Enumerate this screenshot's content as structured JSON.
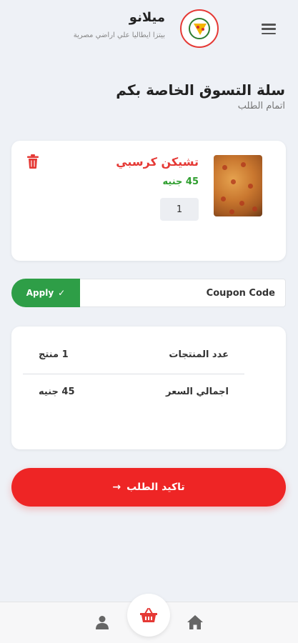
{
  "header": {
    "brand_name": "ميلانو",
    "brand_tagline": "بيتزا ايطاليا علي اراضي مصرية",
    "menu_icon": "hamburger-menu-icon",
    "logo": "pizza-logo"
  },
  "page": {
    "title": "سلة التسوق الخاصة بكم",
    "subtitle": "اتمام الطلب"
  },
  "cart": {
    "items": [
      {
        "name": "تشيكن كرسبي",
        "price": "45 جنيه",
        "quantity": "1",
        "image": "pizza-photo",
        "delete_icon": "trash-icon"
      }
    ]
  },
  "coupon": {
    "label": "Coupon Code",
    "apply_label": "Apply",
    "apply_icon": "check-icon"
  },
  "summary": {
    "count_label": "عدد المنتجات",
    "count_value": "1 منتج",
    "total_label": "اجمالي السعر",
    "total_value": "45 جنيه"
  },
  "confirm": {
    "label": "تاكيد الطلب",
    "arrow_icon": "arrow-right-icon"
  },
  "nav": {
    "items": [
      "user-icon",
      "cart-icon",
      "home-icon"
    ]
  },
  "colors": {
    "accent_red": "#ee2525",
    "price_green": "#2e9e2e",
    "apply_green": "#2e9e47",
    "background": "#eef1f6"
  }
}
